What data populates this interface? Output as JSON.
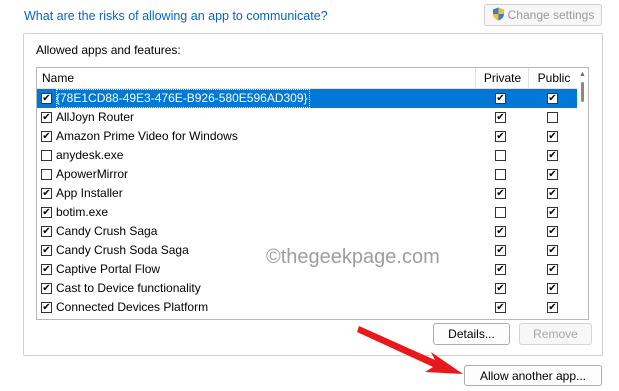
{
  "header": {
    "risk_link": "What are the risks of allowing an app to communicate?",
    "change_settings_label": "Change settings"
  },
  "group": {
    "label": "Allowed apps and features:"
  },
  "table": {
    "col_name": "Name",
    "col_private": "Private",
    "col_public": "Public",
    "rows": [
      {
        "name": "{78E1CD88-49E3-476E-B926-580E596AD309}",
        "enabled": true,
        "private": true,
        "public": true,
        "selected": true
      },
      {
        "name": "AllJoyn Router",
        "enabled": true,
        "private": true,
        "public": false,
        "selected": false
      },
      {
        "name": "Amazon Prime Video for Windows",
        "enabled": true,
        "private": true,
        "public": true,
        "selected": false
      },
      {
        "name": "anydesk.exe",
        "enabled": false,
        "private": false,
        "public": true,
        "selected": false
      },
      {
        "name": "ApowerMirror",
        "enabled": false,
        "private": false,
        "public": true,
        "selected": false
      },
      {
        "name": "App Installer",
        "enabled": true,
        "private": true,
        "public": true,
        "selected": false
      },
      {
        "name": "botim.exe",
        "enabled": true,
        "private": false,
        "public": true,
        "selected": false
      },
      {
        "name": "Candy Crush Saga",
        "enabled": true,
        "private": true,
        "public": true,
        "selected": false
      },
      {
        "name": "Candy Crush Soda Saga",
        "enabled": true,
        "private": true,
        "public": true,
        "selected": false
      },
      {
        "name": "Captive Portal Flow",
        "enabled": true,
        "private": true,
        "public": true,
        "selected": false
      },
      {
        "name": "Cast to Device functionality",
        "enabled": true,
        "private": true,
        "public": true,
        "selected": false
      },
      {
        "name": "Connected Devices Platform",
        "enabled": true,
        "private": true,
        "public": true,
        "selected": false
      }
    ]
  },
  "buttons": {
    "details": "Details...",
    "remove": "Remove",
    "allow_another": "Allow another app..."
  },
  "watermark": "©thegeekpage.com",
  "colors": {
    "link": "#0066cc",
    "selection": "#0078d7",
    "arrow": "#e8191a"
  },
  "icons": {
    "shield": "uac-shield-icon",
    "arrow": "red-pointer-arrow"
  }
}
